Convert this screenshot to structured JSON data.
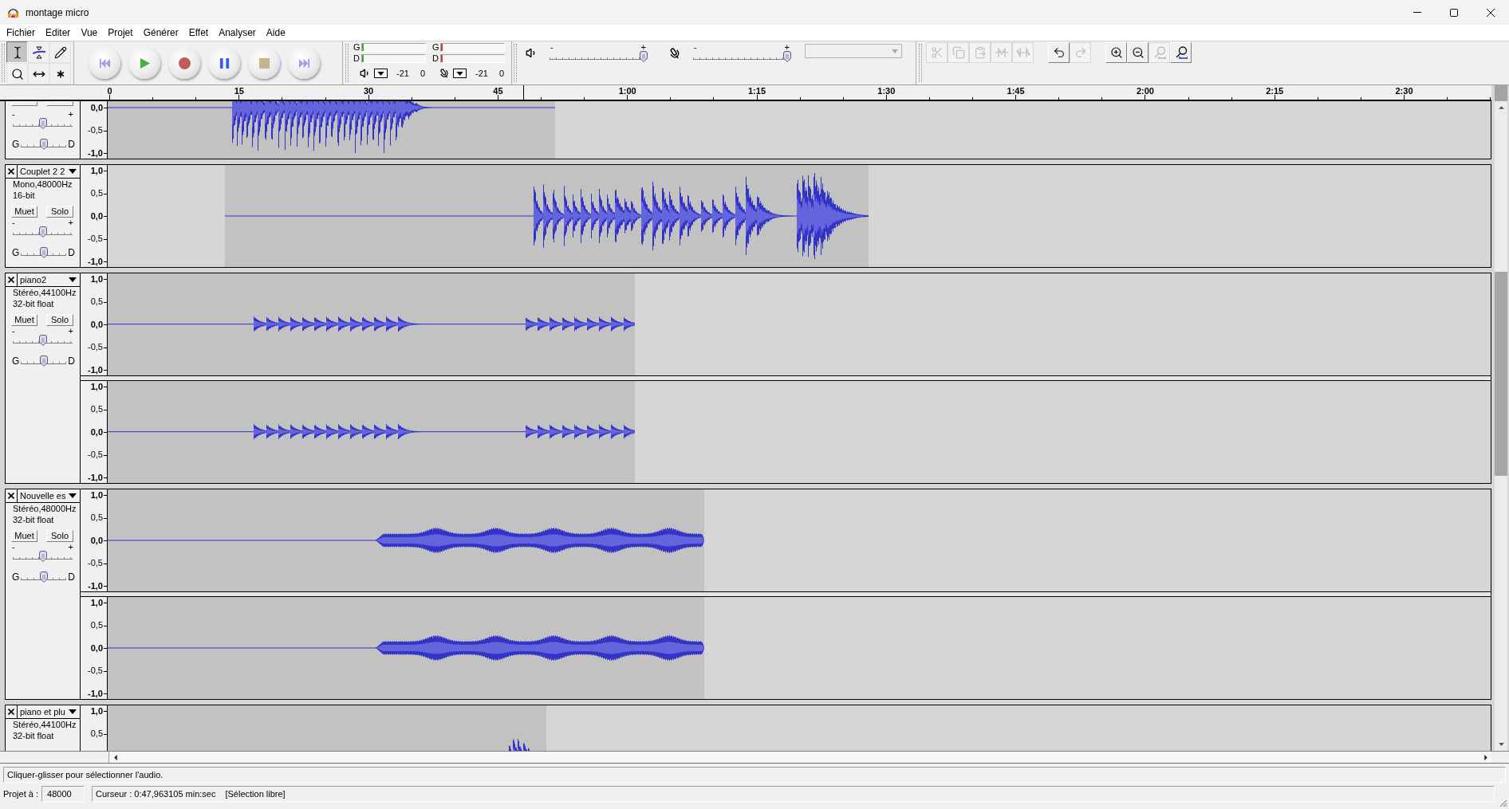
{
  "window": {
    "title": "montage micro"
  },
  "menu": [
    "Fichier",
    "Editer",
    "Vue",
    "Projet",
    "Générer",
    "Effet",
    "Analyser",
    "Aide"
  ],
  "tools": [
    {
      "kind": "select",
      "selected": true
    },
    {
      "kind": "envelope",
      "selected": false
    },
    {
      "kind": "draw",
      "selected": false
    },
    {
      "kind": "zoom",
      "selected": false
    },
    {
      "kind": "time_shift",
      "selected": false
    },
    {
      "kind": "multi",
      "selected": false
    }
  ],
  "meters": [
    {
      "kind": "playback",
      "channels": [
        {
          "label": "G",
          "level": 0
        },
        {
          "label": "D",
          "level": 0
        }
      ],
      "scale": [
        "-21",
        "0"
      ]
    },
    {
      "kind": "recording",
      "channels": [
        {
          "label": "G",
          "level": 0
        },
        {
          "label": "D",
          "level": 0
        }
      ],
      "scale": [
        "-21",
        "0"
      ]
    }
  ],
  "mixer": [
    {
      "kind": "playback",
      "min_label": "-",
      "max_label": "+",
      "level": 1
    },
    {
      "kind": "recording",
      "min_label": "-",
      "max_label": "+",
      "level": 1
    }
  ],
  "input_device": {
    "disabled": true
  },
  "edit_tools": [
    {
      "kind": "cut",
      "disabled": true
    },
    {
      "kind": "copy",
      "disabled": true
    },
    {
      "kind": "paste",
      "disabled": true
    },
    {
      "kind": "trim",
      "disabled": true
    },
    {
      "kind": "silence",
      "disabled": true
    },
    {
      "kind": "undo",
      "disabled": false
    },
    {
      "kind": "redo",
      "disabled": true
    },
    {
      "kind": "zoom_in",
      "disabled": false
    },
    {
      "kind": "zoom_out",
      "disabled": false
    },
    {
      "kind": "fit_selection",
      "disabled": true
    },
    {
      "kind": "fit_project",
      "disabled": false
    }
  ],
  "timeline": {
    "labels": [
      "0",
      "15",
      "30",
      "45",
      "1:00",
      "1:15",
      "1:30",
      "1:45",
      "2:00",
      "2:15",
      "2:30"
    ]
  },
  "tracks": [
    {
      "mute": {
        "on": false
      },
      "solo": {
        "on": false
      },
      "gain": {
        "min_label": "-",
        "max_label": "+",
        "level": 0.5
      },
      "pan": {
        "min_label": "G",
        "max_label": "D",
        "level": 0.5
      },
      "channels": [
        {
          "ruler": [
            "0,0",
            "-0,5",
            "-1,0"
          ]
        }
      ]
    },
    {
      "name": "Couplet 2 2",
      "format": "Mono,48000Hz",
      "sample_format": "16-bit",
      "mute": {
        "label": "Muet",
        "on": false
      },
      "solo": {
        "label": "Solo",
        "on": false
      },
      "gain": {
        "min_label": "-",
        "max_label": "+",
        "level": 0.5
      },
      "pan": {
        "min_label": "G",
        "max_label": "D",
        "level": 0.5
      },
      "channels": [
        {
          "ruler": [
            "1,0",
            "0,5",
            "0,0",
            "-0,5",
            "-1,0"
          ]
        }
      ]
    },
    {
      "name": "piano2",
      "format": "Stéréo,44100Hz",
      "sample_format": "32-bit float",
      "mute": {
        "label": "Muet",
        "on": false
      },
      "solo": {
        "label": "Solo",
        "on": false
      },
      "gain": {
        "min_label": "-",
        "max_label": "+",
        "level": 0.5
      },
      "pan": {
        "min_label": "G",
        "max_label": "D",
        "level": 0.5
      },
      "channels": [
        {
          "ruler": [
            "1,0",
            "0,5",
            "0,0",
            "-0,5",
            "-1,0"
          ]
        },
        {
          "ruler": [
            "1,0",
            "0,5",
            "0,0",
            "-0,5",
            "-1,0"
          ]
        }
      ]
    },
    {
      "name": "Nouvelle es",
      "format": "Stéréo,48000Hz",
      "sample_format": "32-bit float",
      "mute": {
        "label": "Muet",
        "on": false
      },
      "solo": {
        "label": "Solo",
        "on": false
      },
      "gain": {
        "min_label": "-",
        "max_label": "+",
        "level": 0.5
      },
      "pan": {
        "min_label": "G",
        "max_label": "D",
        "level": 0.5
      },
      "channels": [
        {
          "ruler": [
            "1,0",
            "0,5",
            "0,0",
            "-0,5",
            "-1,0"
          ]
        },
        {
          "ruler": [
            "1,0",
            "0,5",
            "0,0",
            "-0,5",
            "-1,0"
          ]
        }
      ]
    },
    {
      "name": "piano et plu",
      "format": "Stéréo,44100Hz",
      "sample_format": "32-bit float",
      "channels": [
        {
          "ruler": [
            "1,0",
            "0,5"
          ]
        }
      ]
    }
  ],
  "status": {
    "message": "Cliquer-glisser pour sélectionner l'audio.",
    "rate_label": "Projet à :",
    "rate": "48000",
    "cursor": "Curseur : 0:47,963105 min:sec",
    "selection_mode": "[Sélection libre]"
  }
}
